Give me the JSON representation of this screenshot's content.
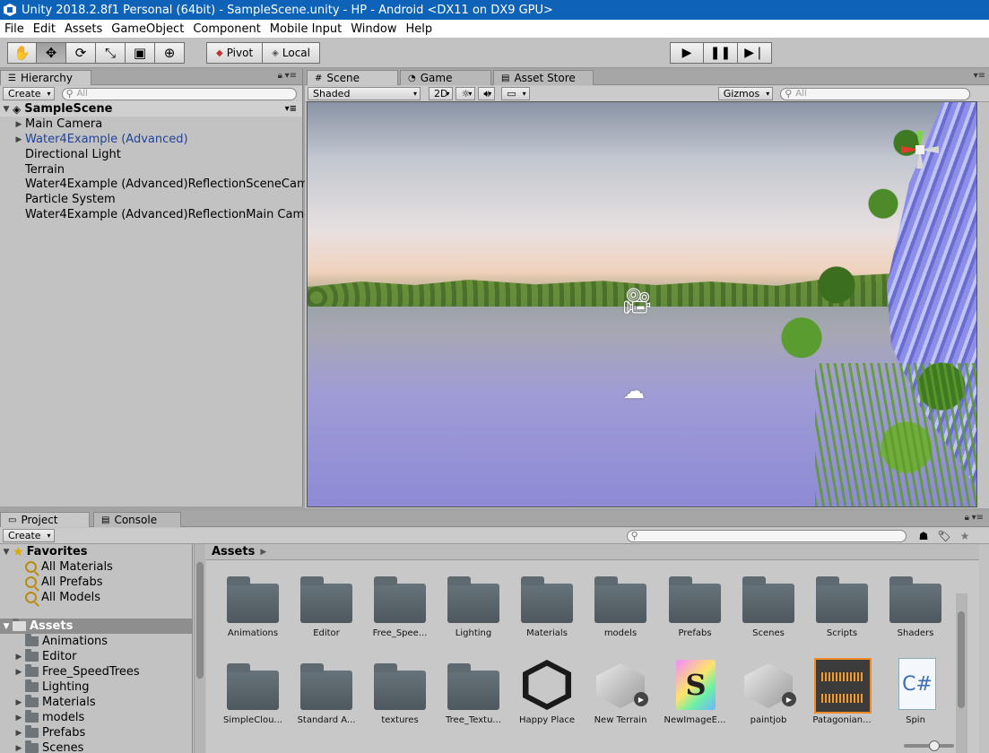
{
  "window": {
    "title": "Unity 2018.2.8f1 Personal (64bit) - SampleScene.unity - HP - Android <DX11 on DX9 GPU>"
  },
  "menu": [
    "File",
    "Edit",
    "Assets",
    "GameObject",
    "Component",
    "Mobile Input",
    "Window",
    "Help"
  ],
  "toolbar": {
    "tools": [
      "hand-icon",
      "move-icon",
      "rotate-icon",
      "scale-icon",
      "rect-icon",
      "transform-icon"
    ],
    "active_tool": "move-icon",
    "pivot_label": "Pivot",
    "local_label": "Local",
    "playback": [
      "play-icon",
      "pause-icon",
      "step-icon"
    ]
  },
  "hierarchy": {
    "tab_label": "Hierarchy",
    "create_label": "Create",
    "search_placeholder": "All",
    "root": "SampleScene",
    "items": [
      {
        "label": "Main Camera",
        "expandable": true
      },
      {
        "label": "Water4Example (Advanced)",
        "expandable": true,
        "highlight": true
      },
      {
        "label": "Directional Light",
        "expandable": false
      },
      {
        "label": "Terrain",
        "expandable": false
      },
      {
        "label": "Water4Example (Advanced)ReflectionSceneCamera",
        "expandable": false
      },
      {
        "label": "Particle System",
        "expandable": false
      },
      {
        "label": "Water4Example (Advanced)ReflectionMain Camera",
        "expandable": false
      }
    ]
  },
  "scene": {
    "tabs": [
      "Scene",
      "Game",
      "Asset Store"
    ],
    "shading_label": "Shaded",
    "mode_2d_label": "2D",
    "gizmos_label": "Gizmos",
    "search_placeholder": "All"
  },
  "project": {
    "tabs": [
      "Project",
      "Console"
    ],
    "create_label": "Create",
    "favorites_label": "Favorites",
    "favorites": [
      "All Materials",
      "All Prefabs",
      "All Models"
    ],
    "assets_label": "Assets",
    "tree": [
      {
        "label": "Animations",
        "expandable": false
      },
      {
        "label": "Editor",
        "expandable": true
      },
      {
        "label": "Free_SpeedTrees",
        "expandable": true
      },
      {
        "label": "Lighting",
        "expandable": false
      },
      {
        "label": "Materials",
        "expandable": true
      },
      {
        "label": "models",
        "expandable": true
      },
      {
        "label": "Prefabs",
        "expandable": true
      },
      {
        "label": "Scenes",
        "expandable": true
      }
    ],
    "breadcrumb": "Assets",
    "grid": [
      {
        "label": "Animations",
        "kind": "folder"
      },
      {
        "label": "Editor",
        "kind": "folder"
      },
      {
        "label": "Free_Spee...",
        "kind": "folder"
      },
      {
        "label": "Lighting",
        "kind": "folder"
      },
      {
        "label": "Materials",
        "kind": "folder"
      },
      {
        "label": "models",
        "kind": "folder"
      },
      {
        "label": "Prefabs",
        "kind": "folder"
      },
      {
        "label": "Scenes",
        "kind": "folder"
      },
      {
        "label": "Scripts",
        "kind": "folder"
      },
      {
        "label": "Shaders",
        "kind": "folder"
      },
      {
        "label": "SimpleClou...",
        "kind": "folder"
      },
      {
        "label": "Standard A...",
        "kind": "folder"
      },
      {
        "label": "textures",
        "kind": "folder"
      },
      {
        "label": "Tree_Textu...",
        "kind": "folder"
      },
      {
        "label": "Happy Place",
        "kind": "scene"
      },
      {
        "label": "New Terrain",
        "kind": "terrain"
      },
      {
        "label": "NewImageE...",
        "kind": "shader"
      },
      {
        "label": "paintjob",
        "kind": "terrain"
      },
      {
        "label": "Patagonian...",
        "kind": "audio"
      },
      {
        "label": "Spin",
        "kind": "script"
      }
    ],
    "shader_glyph": "S",
    "script_glyph": "C#"
  }
}
